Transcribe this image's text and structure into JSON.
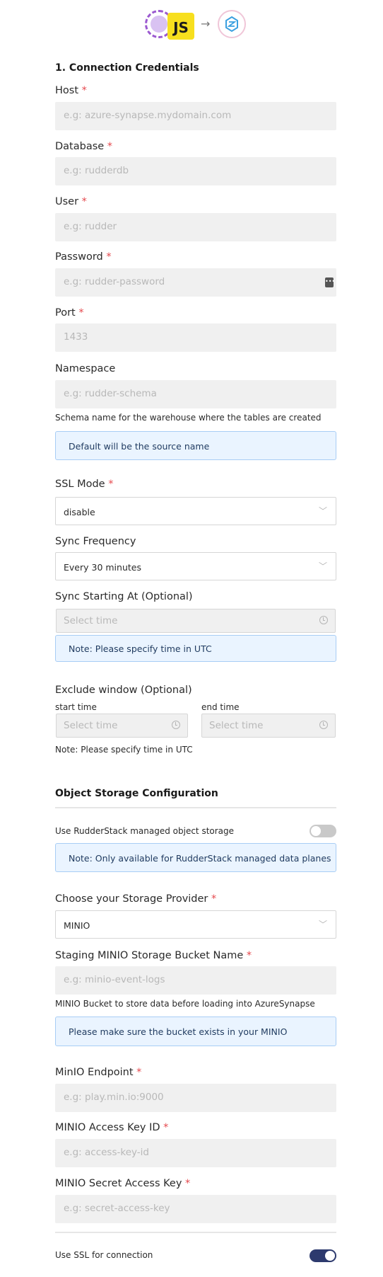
{
  "header": {
    "source_logo_text": "JS",
    "arrow": "→"
  },
  "section1": {
    "title": "1. Connection Credentials"
  },
  "fields": {
    "host": {
      "label": "Host",
      "placeholder": "e.g: azure-synapse.mydomain.com"
    },
    "database": {
      "label": "Database",
      "placeholder": "e.g: rudderdb"
    },
    "user": {
      "label": "User",
      "placeholder": "e.g: rudder"
    },
    "password": {
      "label": "Password",
      "placeholder": "e.g: rudder-password"
    },
    "port": {
      "label": "Port",
      "placeholder": "1433"
    },
    "namespace": {
      "label": "Namespace",
      "placeholder": "e.g: rudder-schema",
      "help": "Schema name for the warehouse where the tables are created",
      "note": "Default will be the source name"
    },
    "ssl_mode": {
      "label": "SSL Mode",
      "value": "disable"
    },
    "sync_frequency": {
      "label": "Sync Frequency",
      "value": "Every 30 minutes"
    },
    "sync_starting_at": {
      "label": "Sync Starting At (Optional)",
      "placeholder": "Select time",
      "note": "Note: Please specify time in UTC"
    },
    "exclude_window": {
      "label": "Exclude window (Optional)",
      "start_label": "start time",
      "end_label": "end time",
      "start_placeholder": "Select time",
      "end_placeholder": "Select time",
      "note": "Note: Please specify time in UTC"
    }
  },
  "object_storage": {
    "title": "Object Storage Configuration",
    "managed_label": "Use RudderStack managed object storage",
    "managed_enabled": false,
    "managed_note": "Note: Only available for RudderStack managed data planes",
    "provider_label": "Choose your Storage Provider",
    "provider_value": "MINIO",
    "bucket_label": "Staging MINIO Storage Bucket Name",
    "bucket_placeholder": "e.g: minio-event-logs",
    "bucket_help": "MINIO Bucket to store data before loading into AzureSynapse",
    "bucket_note": "Please make sure the bucket exists in your MINIO",
    "endpoint_label": "MinIO Endpoint",
    "endpoint_placeholder": "e.g: play.min.io:9000",
    "access_key_label": "MINIO Access Key ID",
    "access_key_placeholder": "e.g: access-key-id",
    "secret_key_label": "MINIO Secret Access Key",
    "secret_key_placeholder": "e.g: secret-access-key",
    "ssl_label": "Use SSL for connection",
    "ssl_enabled": true
  },
  "common": {
    "required_mark": "*",
    "chevron": "﹀"
  },
  "colors": {
    "required": "#e5484d",
    "note_bg": "#eaf4ff",
    "note_border": "#a8cdf5",
    "toggle_on": "#2d3a6e",
    "toggle_off": "#c9c9c9"
  }
}
